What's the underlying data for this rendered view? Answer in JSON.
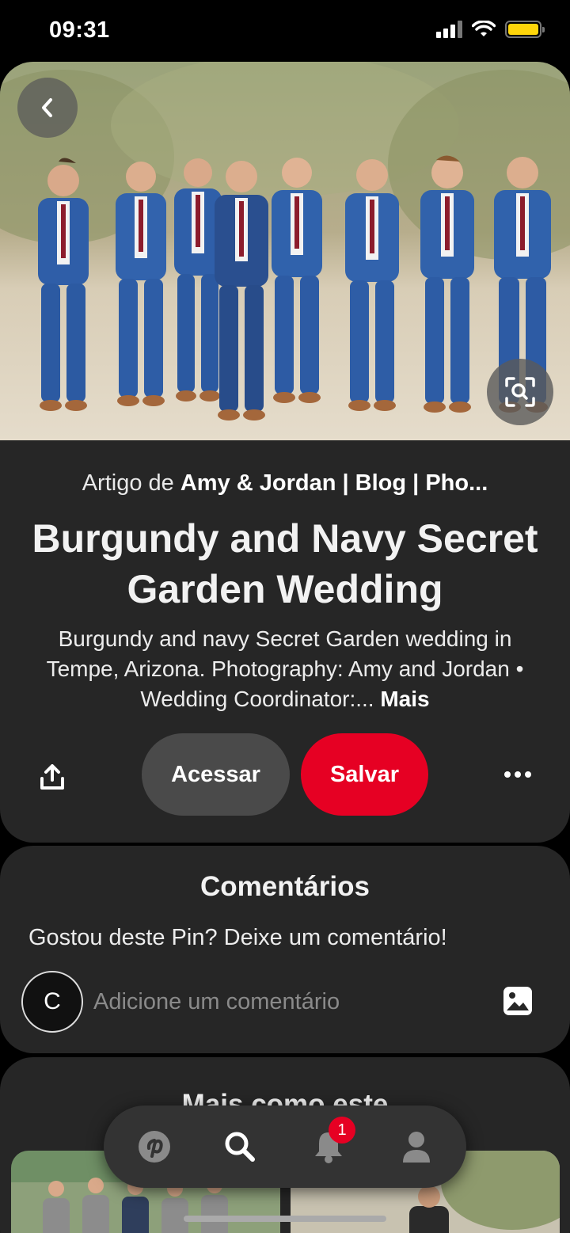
{
  "status_bar": {
    "time": "09:31",
    "icons": [
      "signal-icon",
      "wifi-icon",
      "battery-icon"
    ],
    "battery_color": "#ffd60a"
  },
  "pin": {
    "source_prefix": "Artigo de",
    "source_name": "Amy & Jordan | Blog | Pho...",
    "title": "Burgundy and Navy Secret Garden Wedding",
    "description": "Burgundy and navy Secret Garden wedding in Tempe, Arizona. Photography: Amy and Jordan • Wedding Coordinator:...",
    "more_label": "Mais",
    "actions": {
      "visit_label": "Acessar",
      "save_label": "Salvar"
    },
    "save_color": "#e60023"
  },
  "comments": {
    "title": "Comentários",
    "prompt": "Gostou deste Pin? Deixe um comentário!",
    "avatar_initial": "C",
    "input_placeholder": "Adicione um comentário"
  },
  "more_like_this": {
    "title": "Mais como este"
  },
  "bottom_nav": {
    "items": [
      "pinterest-home-icon",
      "search-icon",
      "notifications-bell-icon",
      "profile-icon"
    ],
    "notification_count": "1"
  }
}
